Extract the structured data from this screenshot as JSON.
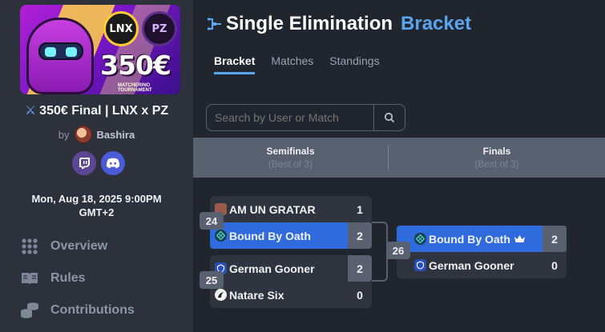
{
  "tournament": {
    "banner": {
      "prize": "350€",
      "logo_left": "LNX",
      "logo_right": "PZ",
      "caption": "MATCHERINO TOURNAMENT"
    },
    "title": "350€ Final | LNX x PZ",
    "by_label": "by",
    "host": "Bashira",
    "date_line1": "Mon, Aug 18, 2025 9:00PM",
    "date_line2": "GMT+2"
  },
  "sidebar": {
    "items": [
      {
        "label": "Overview",
        "icon": "grid-icon"
      },
      {
        "label": "Rules",
        "icon": "book-icon"
      },
      {
        "label": "Contributions",
        "icon": "coins-icon"
      }
    ]
  },
  "main": {
    "title": "Single Elimination",
    "title_accent": "Bracket",
    "tabs": [
      {
        "label": "Bracket",
        "active": true
      },
      {
        "label": "Matches",
        "active": false
      },
      {
        "label": "Standings",
        "active": false
      }
    ],
    "search_placeholder": "Search by User or Match"
  },
  "rounds": [
    {
      "name": "Semifinals",
      "best_of": "(Best of 3)"
    },
    {
      "name": "Finals",
      "best_of": "(Best of 3)"
    }
  ],
  "matches": [
    {
      "number": "24",
      "slots": [
        {
          "team": "AM UN GRATAR",
          "score": "1",
          "winner": false
        },
        {
          "team": "Bound By Oath",
          "score": "2",
          "winner": true
        }
      ]
    },
    {
      "number": "25",
      "slots": [
        {
          "team": "German Gooner",
          "score": "2",
          "winner": false
        },
        {
          "team": "Natare Six",
          "score": "0",
          "winner": false
        }
      ]
    },
    {
      "number": "26",
      "slots": [
        {
          "team": "Bound By Oath",
          "score": "2",
          "winner": true,
          "crown": true
        },
        {
          "team": "German Gooner",
          "score": "0",
          "winner": false
        }
      ]
    }
  ],
  "colors": {
    "accent": "#5aa5ef",
    "winner": "#2f6bdc",
    "panel": "#2c313c",
    "background": "#21252e"
  }
}
